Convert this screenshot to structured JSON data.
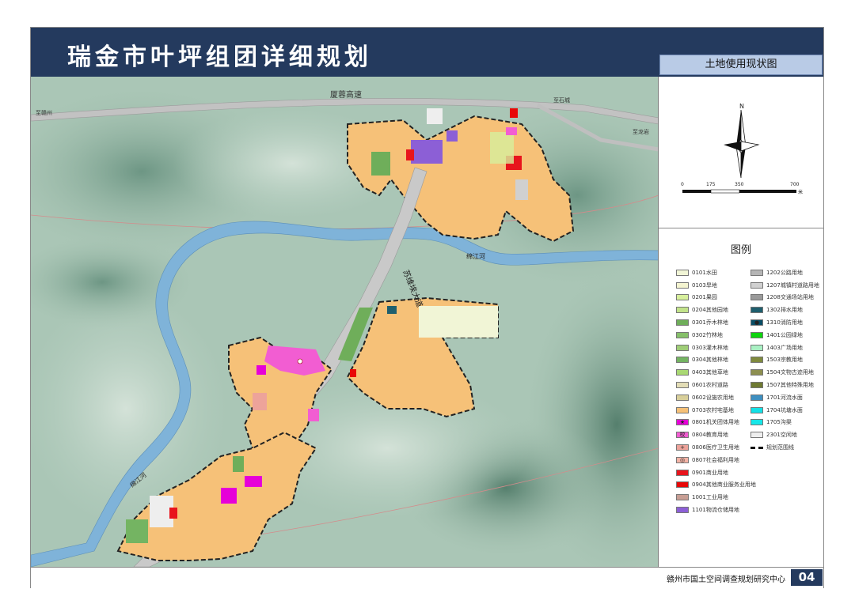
{
  "header": {
    "title": "瑞金市叶坪组团详细规划",
    "subtitle": "土地使用现状图"
  },
  "map_labels": {
    "expressway": "厦蓉高速",
    "to_ganzhou": "至赣州",
    "to_shicheng": "至石城",
    "to_longyan": "至龙岩",
    "avenue": "苏维埃大道",
    "river_mianjiang": "绵江河",
    "river_left": "绵江河"
  },
  "north_arrow": {
    "symbol": "N",
    "scale_ticks": [
      "0",
      "175",
      "350",
      "700"
    ],
    "scale_unit": "米"
  },
  "legend": {
    "title": "图例",
    "left": [
      {
        "code": "0101水田",
        "color": "#f1f5d6"
      },
      {
        "code": "0103旱地",
        "color": "#f4f4d0"
      },
      {
        "code": "0201果园",
        "color": "#d7ef9c"
      },
      {
        "code": "0204其他园地",
        "color": "#c2e38a"
      },
      {
        "code": "0301乔木林地",
        "color": "#6fae5a"
      },
      {
        "code": "0302竹林地",
        "color": "#86c06a"
      },
      {
        "code": "0303灌木林地",
        "color": "#9fcd77"
      },
      {
        "code": "0304其他林地",
        "color": "#74b462"
      },
      {
        "code": "0403其他草地",
        "color": "#a9d873"
      },
      {
        "code": "0601农村道路",
        "color": "#e3ddb6"
      },
      {
        "code": "0602设施农用地",
        "color": "#d8cf9a"
      },
      {
        "code": "0703农村宅基地",
        "color": "#f6c178"
      },
      {
        "code": "0801机关团体用地",
        "color": "#e600d8",
        "symbol": "★"
      },
      {
        "code": "0804教育用地",
        "color": "#f25dd2",
        "symbol": "校"
      },
      {
        "code": "0806医疗卫生用地",
        "color": "#eda39a",
        "symbol": "+"
      },
      {
        "code": "0807社会福利用地",
        "color": "#f4b4a6",
        "symbol": "◎"
      },
      {
        "code": "0901商业用地",
        "color": "#e8141c"
      },
      {
        "code": "0904其他商业服务业用地",
        "color": "#e80808"
      },
      {
        "code": "1001工业用地",
        "color": "#c79e94"
      },
      {
        "code": "1101物流仓储用地",
        "color": "#8c5fd6"
      }
    ],
    "right": [
      {
        "code": "1202公路用地",
        "color": "#b5b5b5"
      },
      {
        "code": "1207城镇村道路用地",
        "color": "#d0d0d0"
      },
      {
        "code": "1208交通场站用地",
        "color": "#9a9a9a"
      },
      {
        "code": "1302排水用地",
        "color": "#1f5f6e"
      },
      {
        "code": "1310消防用地",
        "color": "#0a4e66",
        "symbol": "●"
      },
      {
        "code": "1401公园绿地",
        "color": "#0ed40e"
      },
      {
        "code": "1403广场用地",
        "color": "#a9f0c3"
      },
      {
        "code": "1503宗教用地",
        "color": "#7f8a3e"
      },
      {
        "code": "1504文物古迹用地",
        "color": "#8d8f50"
      },
      {
        "code": "1507其他特殊用地",
        "color": "#6f7a32"
      },
      {
        "code": "1701河流水面",
        "color": "#3f8fc0"
      },
      {
        "code": "1704坑塘水面",
        "color": "#14e0e6"
      },
      {
        "code": "1705沟渠",
        "color": "#17e6e8"
      },
      {
        "code": "2301空闲地",
        "color": "#eeeeee"
      },
      {
        "code": "规划范围线",
        "boundary": true
      }
    ]
  },
  "footer": {
    "org": "赣州市国土空间调查规划研究中心",
    "page": "04"
  },
  "colors": {
    "header_bg": "#243a5e",
    "residential": "#f6c178",
    "water": "#7fb3d9",
    "terrain": "#a9c7b5"
  }
}
